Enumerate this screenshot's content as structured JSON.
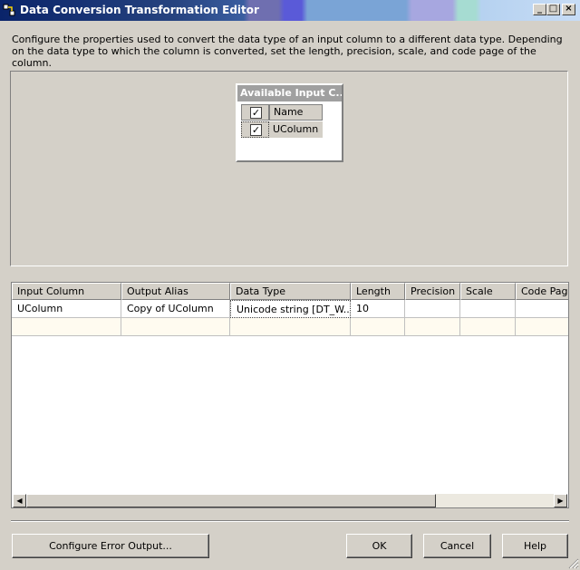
{
  "window": {
    "title": "Data Conversion Transformation Editor",
    "minimize": "_",
    "maximize": "□",
    "close": "×"
  },
  "description": "Configure the properties used to convert the data type of an input column to a different data type. Depending on the data type to which the column is converted, set the length, precision, scale, and code page of the column.",
  "available_columns": {
    "title": "Available Input C...",
    "header_check": "✓",
    "header_label": "Name",
    "items": [
      {
        "checked": "✓",
        "name": "UColumn"
      }
    ]
  },
  "grid": {
    "columns": [
      "Input Column",
      "Output Alias",
      "Data Type",
      "Length",
      "Precision",
      "Scale",
      "Code Page"
    ],
    "rows": [
      [
        "UColumn",
        "Copy of UColumn",
        "Unicode string [DT_W...",
        "10",
        "",
        "",
        ""
      ]
    ],
    "scroll_left": "◀",
    "scroll_right": "▶"
  },
  "buttons": {
    "configure_error_output": "Configure Error Output...",
    "ok": "OK",
    "cancel": "Cancel",
    "help": "Help"
  },
  "colors": {
    "titlebar_start": "#0a246a",
    "dialog_face": "#d4d0c8",
    "new_row": "#fffbf0"
  }
}
